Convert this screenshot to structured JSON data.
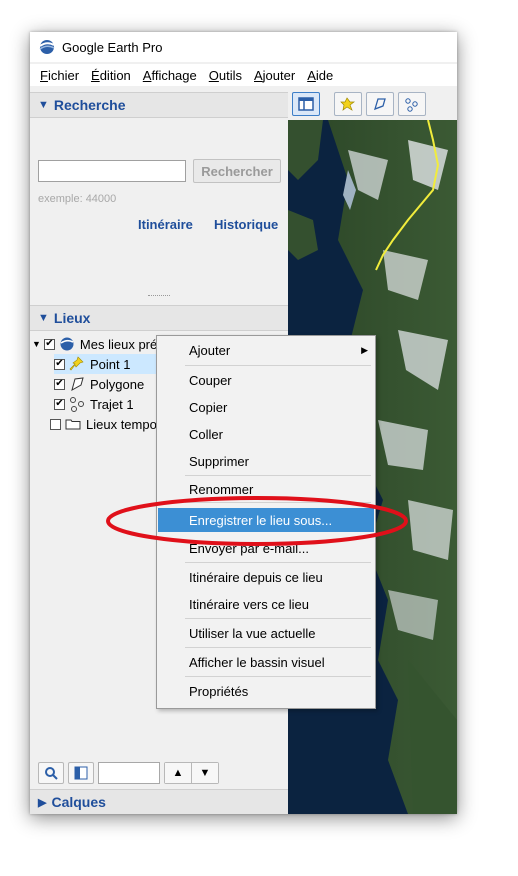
{
  "window": {
    "title": "Google Earth Pro"
  },
  "menubar": [
    {
      "label": "Fichier"
    },
    {
      "label": "Édition"
    },
    {
      "label": "Affichage"
    },
    {
      "label": "Outils"
    },
    {
      "label": "Ajouter"
    },
    {
      "label": "Aide"
    }
  ],
  "search": {
    "header": "Recherche",
    "input_value": "",
    "button_label": "Rechercher",
    "example": "exemple: 44000",
    "links": [
      "Itinéraire",
      "Historique"
    ]
  },
  "places": {
    "header": "Lieux",
    "items": [
      {
        "label": "Mes lieux préférés",
        "checked": true,
        "icon": "earth-icon"
      },
      {
        "label": "Point 1",
        "checked": true,
        "icon": "pushpin-icon",
        "selected": true
      },
      {
        "label": "Polygone",
        "checked": true,
        "icon": "polygon-icon"
      },
      {
        "label": "Trajet 1",
        "checked": true,
        "icon": "path-icon"
      },
      {
        "label": "Lieux temporaires",
        "checked": false,
        "icon": "folder-icon"
      }
    ]
  },
  "layers": {
    "header": "Calques"
  },
  "context_menu": {
    "items": [
      {
        "label": "Ajouter",
        "submenu": true
      },
      {
        "label": "Couper"
      },
      {
        "label": "Copier"
      },
      {
        "label": "Coller"
      },
      {
        "label": "Supprimer"
      },
      {
        "label": "Renommer"
      },
      {
        "label": "Enregistrer le lieu sous...",
        "highlighted": true
      },
      {
        "label": "Envoyer par e-mail..."
      },
      {
        "label": "Itinéraire depuis ce lieu"
      },
      {
        "label": "Itinéraire vers ce lieu"
      },
      {
        "label": "Utiliser la vue actuelle"
      },
      {
        "label": "Afficher le bassin visuel"
      },
      {
        "label": "Propriétés"
      }
    ]
  },
  "colors": {
    "accent": "#1f4e9b",
    "selection": "#cce8ff",
    "menu_highlight": "#3c8fd4",
    "annotation": "#e0101a"
  }
}
